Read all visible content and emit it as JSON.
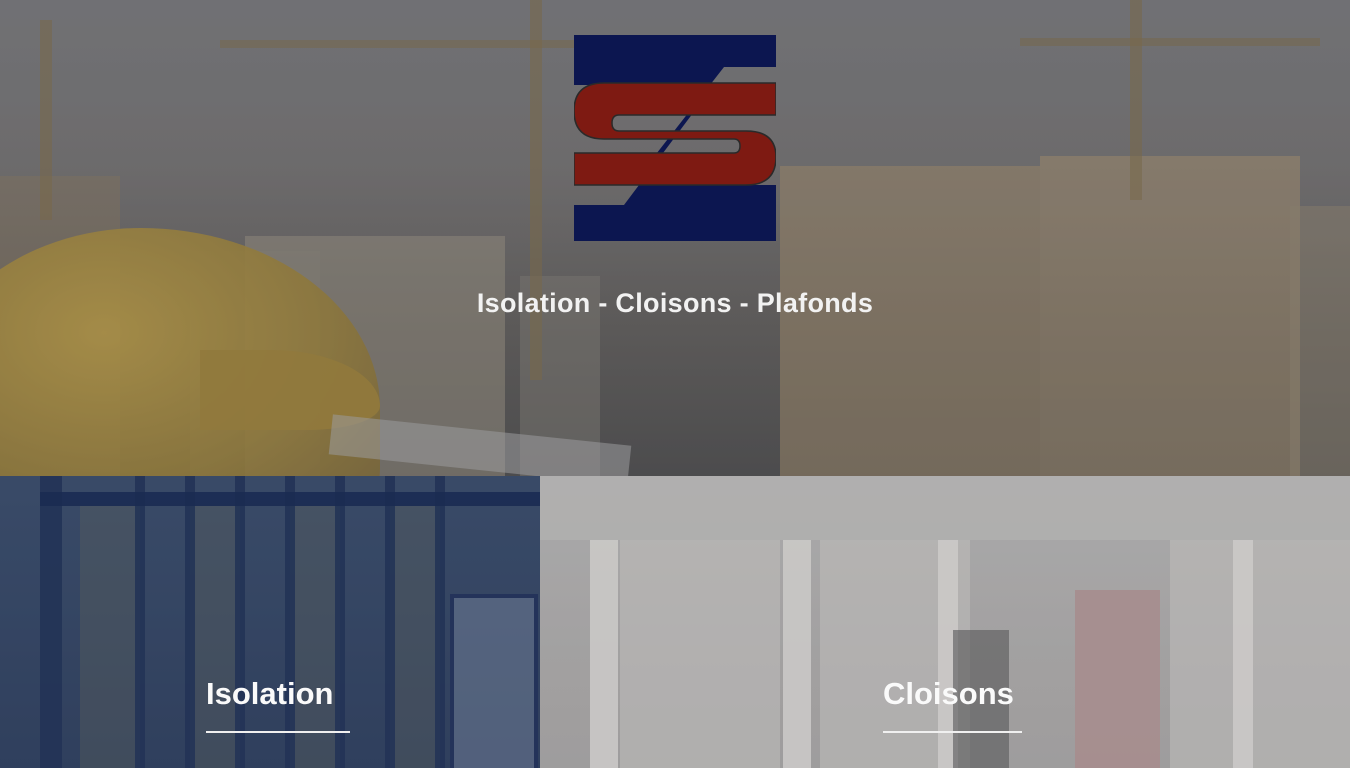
{
  "hero": {
    "tagline": "Isolation - Cloisons - Plafonds",
    "logo_colors": {
      "navy": "#0c1650",
      "red": "#7e1a12"
    }
  },
  "tiles": [
    {
      "title": "Isolation",
      "tint": "#1e3c78"
    },
    {
      "title": "Cloisons",
      "tint": "#b3b1b0"
    }
  ]
}
